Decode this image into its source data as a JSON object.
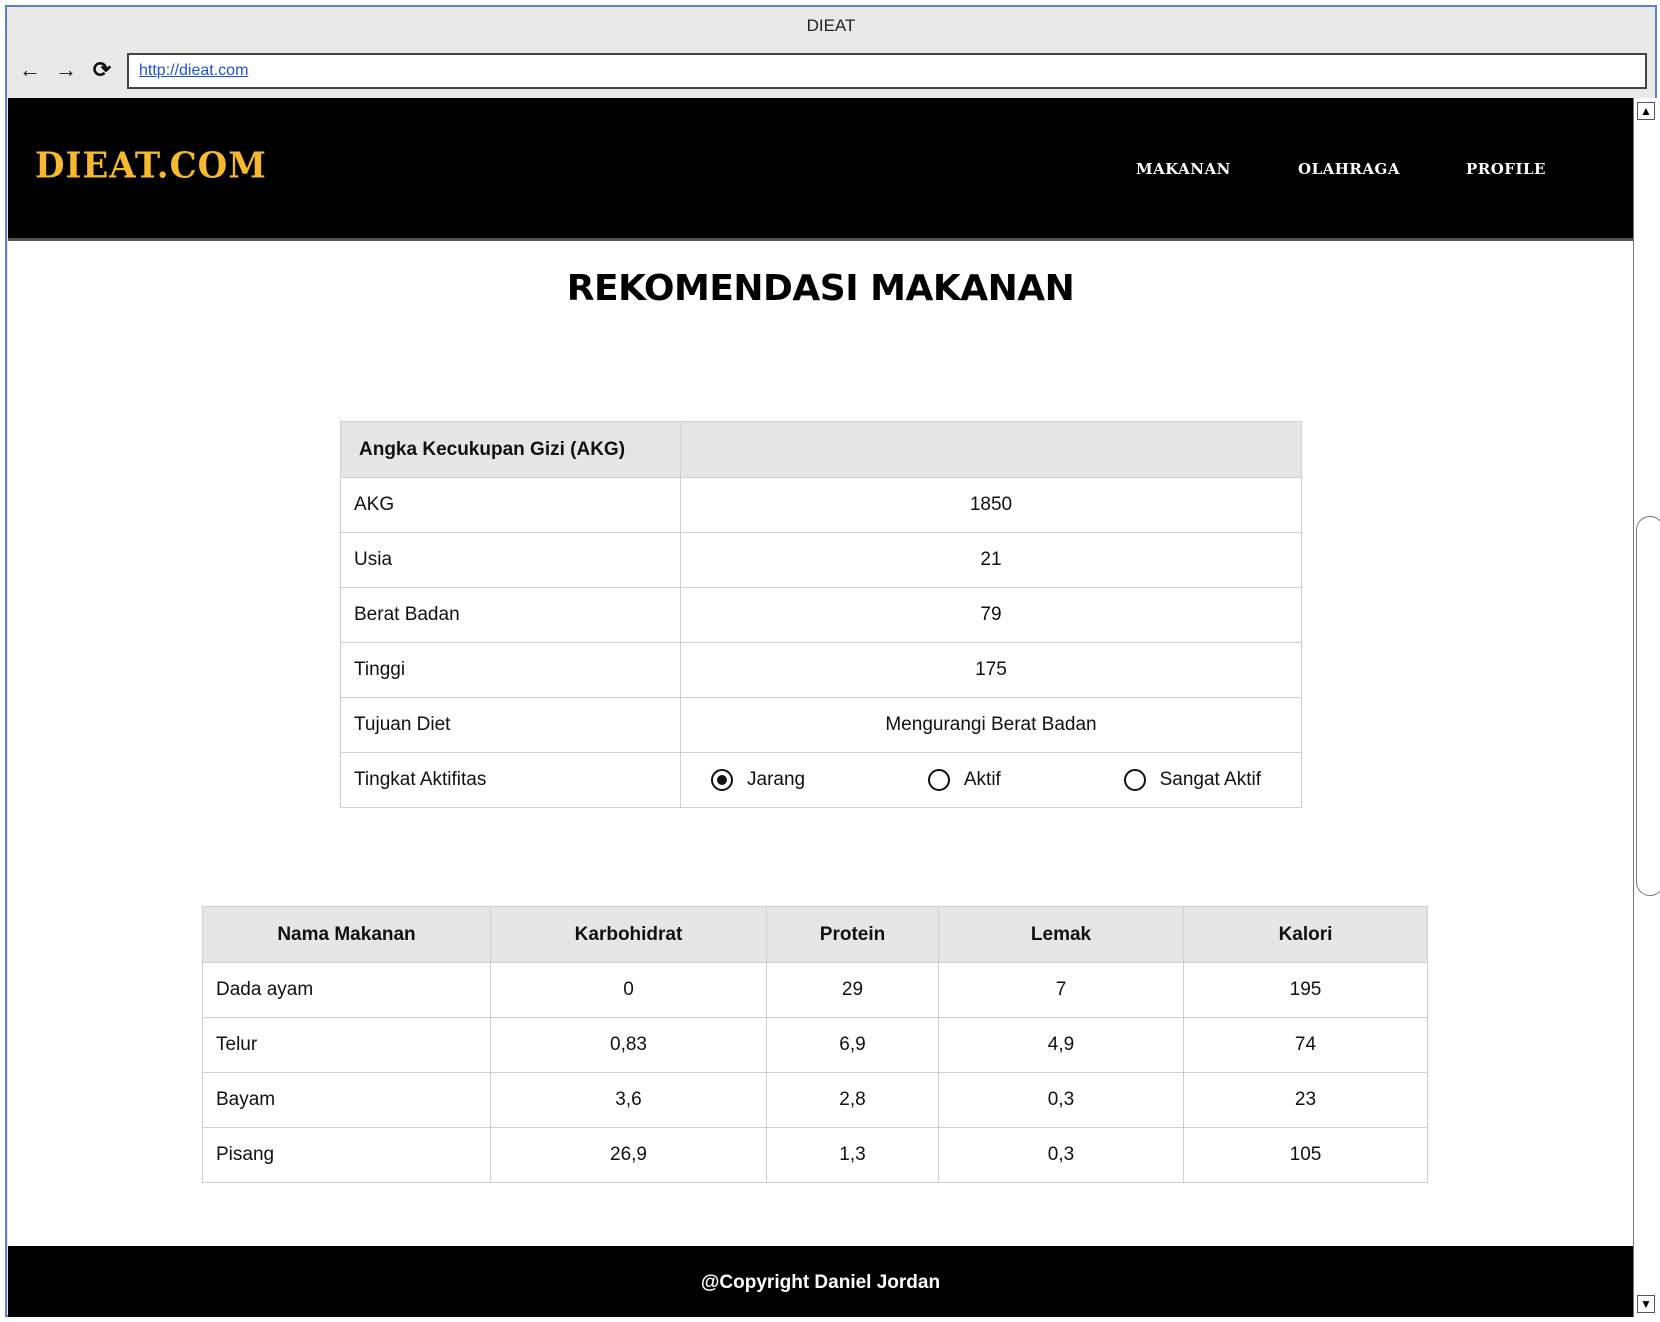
{
  "browser": {
    "title": "DIEAT",
    "url": "http://dieat.com",
    "back_icon": "←",
    "forward_icon": "→",
    "reload_icon": "⟳"
  },
  "site": {
    "logo": "DIEAT.COM",
    "nav": [
      "MAKANAN",
      "OLAHRAGA",
      "PROFILE"
    ],
    "page_title": "REKOMENDASI MAKANAN",
    "footer": "@Copyright Daniel Jordan"
  },
  "akg_table": {
    "header": "Angka Kecukupan Gizi (AKG)",
    "rows": [
      {
        "label": "AKG",
        "value": "1850"
      },
      {
        "label": "Usia",
        "value": "21"
      },
      {
        "label": "Berat Badan",
        "value": "79"
      },
      {
        "label": "Tinggi",
        "value": "175"
      },
      {
        "label": "Tujuan Diet",
        "value": "Mengurangi Berat Badan"
      }
    ],
    "activity_label": "Tingkat Aktifitas",
    "activity_options": [
      "Jarang",
      "Aktif",
      "Sangat Aktif"
    ],
    "activity_selected": "Jarang"
  },
  "food_table": {
    "columns": [
      "Nama Makanan",
      "Karbohidrat",
      "Protein",
      "Lemak",
      "Kalori"
    ],
    "rows": [
      [
        "Dada ayam",
        "0",
        "29",
        "7",
        "195"
      ],
      [
        "Telur",
        "0,83",
        "6,9",
        "4,9",
        "74"
      ],
      [
        "Bayam",
        "3,6",
        "2,8",
        "0,3",
        "23"
      ],
      [
        "Pisang",
        "26,9",
        "1,3",
        "0,3",
        "105"
      ]
    ]
  }
}
